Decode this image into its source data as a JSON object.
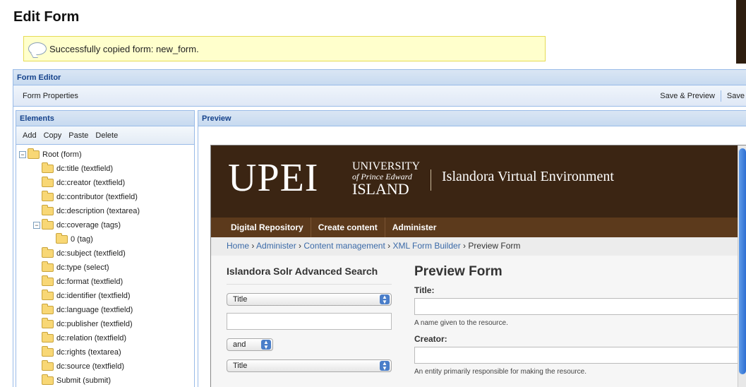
{
  "page": {
    "title": "Edit Form"
  },
  "status": {
    "message": "Successfully copied form: new_form."
  },
  "editor": {
    "title": "Form Editor",
    "toolbar": {
      "properties": "Form Properties",
      "save_preview": "Save & Preview",
      "save": "Save"
    }
  },
  "elements": {
    "title": "Elements",
    "toolbar": {
      "add": "Add",
      "copy": "Copy",
      "paste": "Paste",
      "delete": "Delete"
    },
    "tree": [
      {
        "label": "Root (form)",
        "depth": 0,
        "toggle": "−"
      },
      {
        "label": "dc:title (textfield)",
        "depth": 1
      },
      {
        "label": "dc:creator (textfield)",
        "depth": 1
      },
      {
        "label": "dc:contributor (textfield)",
        "depth": 1
      },
      {
        "label": "dc:description (textarea)",
        "depth": 1
      },
      {
        "label": "dc:coverage (tags)",
        "depth": 1,
        "toggle": "−"
      },
      {
        "label": "0 (tag)",
        "depth": 2
      },
      {
        "label": "dc:subject (textfield)",
        "depth": 1
      },
      {
        "label": "dc:type (select)",
        "depth": 1
      },
      {
        "label": "dc:format (textfield)",
        "depth": 1
      },
      {
        "label": "dc:identifier (textfield)",
        "depth": 1
      },
      {
        "label": "dc:language (textfield)",
        "depth": 1
      },
      {
        "label": "dc:publisher (textfield)",
        "depth": 1
      },
      {
        "label": "dc:relation (textfield)",
        "depth": 1
      },
      {
        "label": "dc:rights (textarea)",
        "depth": 1
      },
      {
        "label": "dc:source (textfield)",
        "depth": 1
      },
      {
        "label": "Submit (submit)",
        "depth": 1
      }
    ]
  },
  "preview": {
    "title": "Preview",
    "site": {
      "logo_main": "UPEI",
      "logo_line1": "UNIVERSITY",
      "logo_line2": "of Prince Edward",
      "logo_line3": "ISLAND",
      "name": "Islandora Virtual Environment"
    },
    "nav": [
      "Digital Repository",
      "Create content",
      "Administer"
    ],
    "breadcrumb": {
      "items": [
        "Home",
        "Administer",
        "Content management",
        "XML Form Builder"
      ],
      "sep": " › ",
      "current": "Preview Form"
    },
    "search": {
      "heading": "Islandora Solr Advanced Search",
      "field1": "Title",
      "operator": "and",
      "field2": "Title"
    },
    "form": {
      "heading": "Preview Form",
      "title_label": "Title:",
      "title_desc": "A name given to the resource.",
      "creator_label": "Creator:",
      "creator_desc": "An entity primarily responsible for making the resource."
    }
  }
}
